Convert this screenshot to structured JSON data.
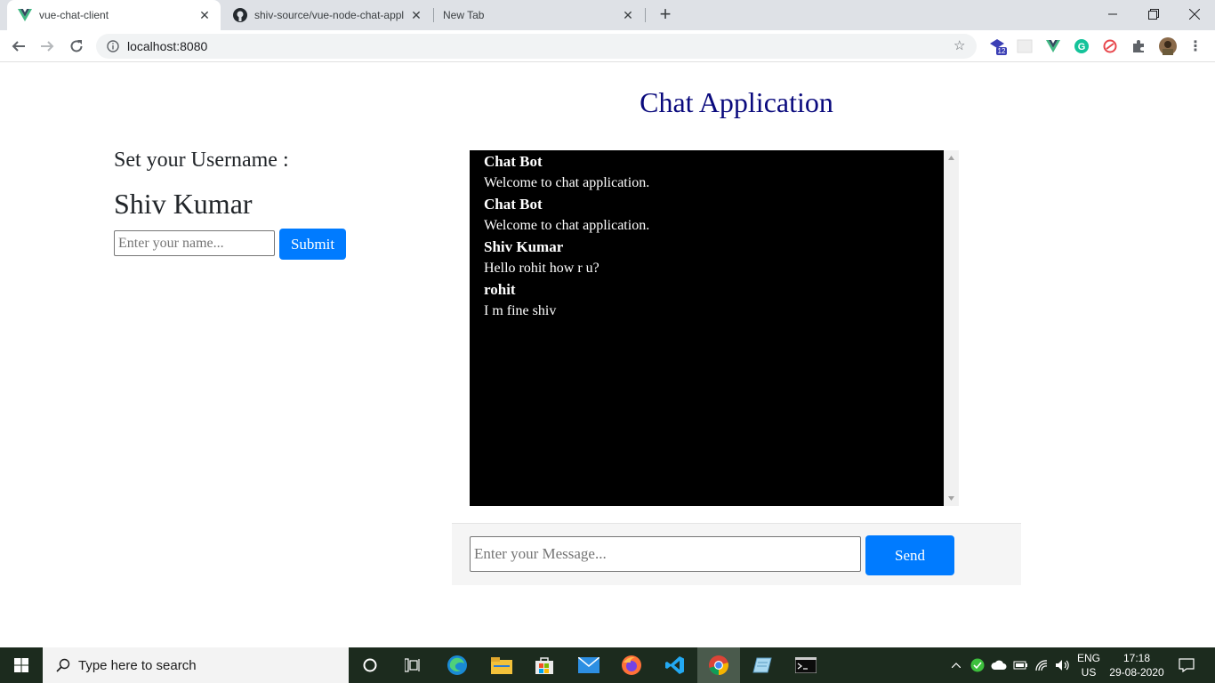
{
  "browser": {
    "tabs": [
      {
        "title": "vue-chat-client",
        "active": true
      },
      {
        "title": "shiv-source/vue-node-chat-appli",
        "active": false
      },
      {
        "title": "New Tab",
        "active": false
      }
    ],
    "url": "localhost:8080",
    "extension_badge": "12"
  },
  "page": {
    "title": "Chat Application",
    "set_label": "Set your Username :",
    "username": "Shiv Kumar",
    "name_placeholder": "Enter your name...",
    "submit_label": "Submit",
    "messages": [
      {
        "user": "Chat Bot",
        "text": "Welcome to chat application."
      },
      {
        "user": "Chat Bot",
        "text": "Welcome to chat application."
      },
      {
        "user": "Shiv Kumar",
        "text": "Hello rohit how r u?"
      },
      {
        "user": "rohit",
        "text": "I m fine shiv"
      }
    ],
    "message_placeholder": "Enter your Message...",
    "send_label": "Send"
  },
  "taskbar": {
    "search_text": "Type here to search",
    "lang": "ENG",
    "region": "US",
    "time": "17:18",
    "date": "29-08-2020"
  },
  "colors": {
    "accent": "#007bff",
    "title": "#0a0a7d",
    "chat_bg": "#000000"
  }
}
